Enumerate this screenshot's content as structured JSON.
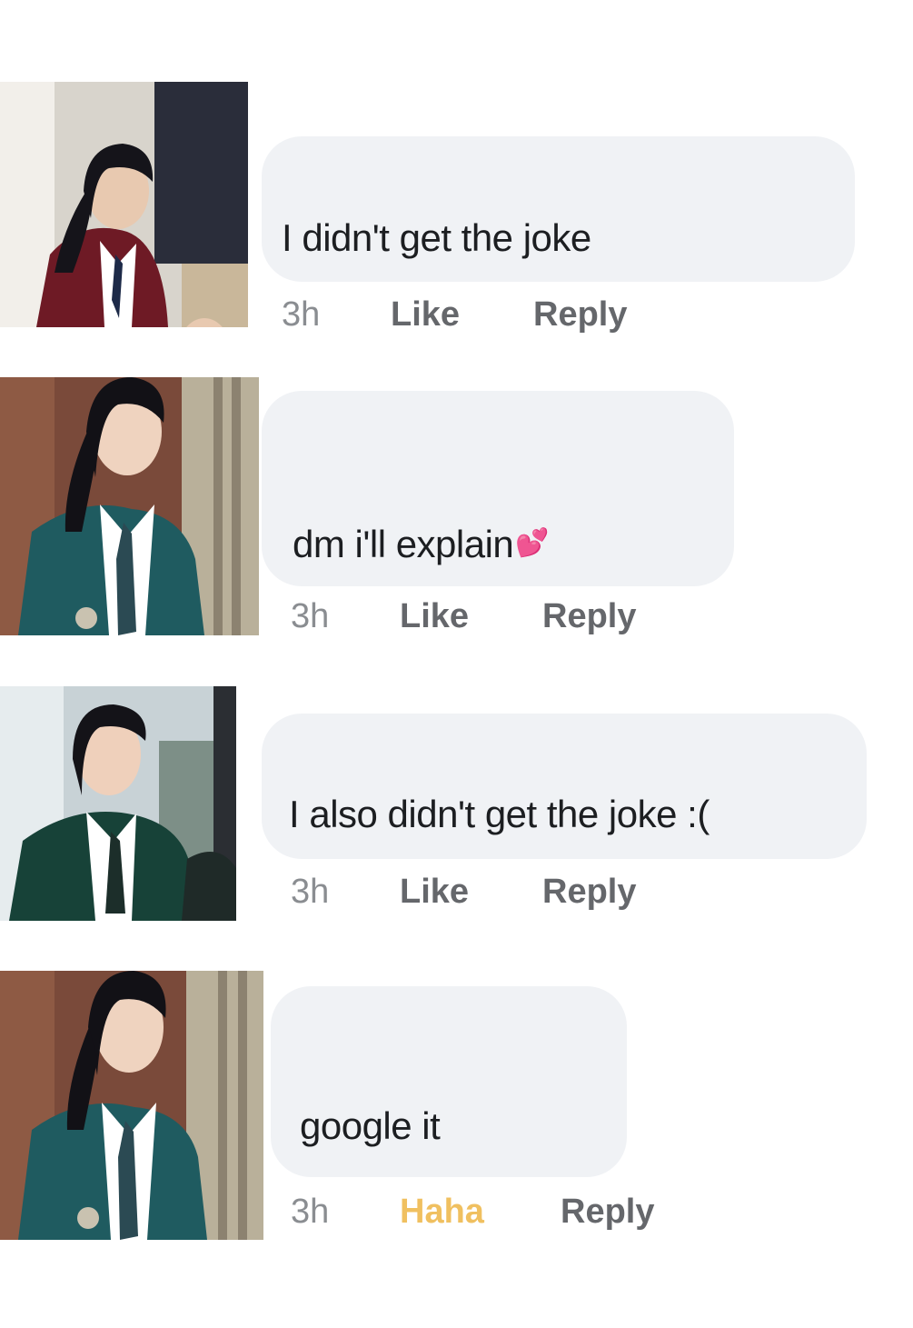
{
  "colors": {
    "bubble": "#f0f2f5",
    "text": "#1c1e21",
    "muted": "#65676b",
    "haha": "#f0c060",
    "heart": "#f26aa8"
  },
  "comments": [
    {
      "avatar_icon": "profile-photo-maroon-blazer",
      "text": "I didn't get the joke",
      "time": "3h",
      "reaction": "Like",
      "reply": "Reply"
    },
    {
      "avatar_icon": "profile-photo-green-blazer",
      "text": "dm i'll explain",
      "emoji": "💕",
      "time": "3h",
      "reaction": "Like",
      "reply": "Reply"
    },
    {
      "avatar_icon": "profile-photo-green-blazer-smiling",
      "text": "I also didn't get the joke :(",
      "time": "3h",
      "reaction": "Like",
      "reply": "Reply"
    },
    {
      "avatar_icon": "profile-photo-green-blazer",
      "text": "google it",
      "time": "3h",
      "reaction": "Haha",
      "reply": "Reply"
    }
  ]
}
